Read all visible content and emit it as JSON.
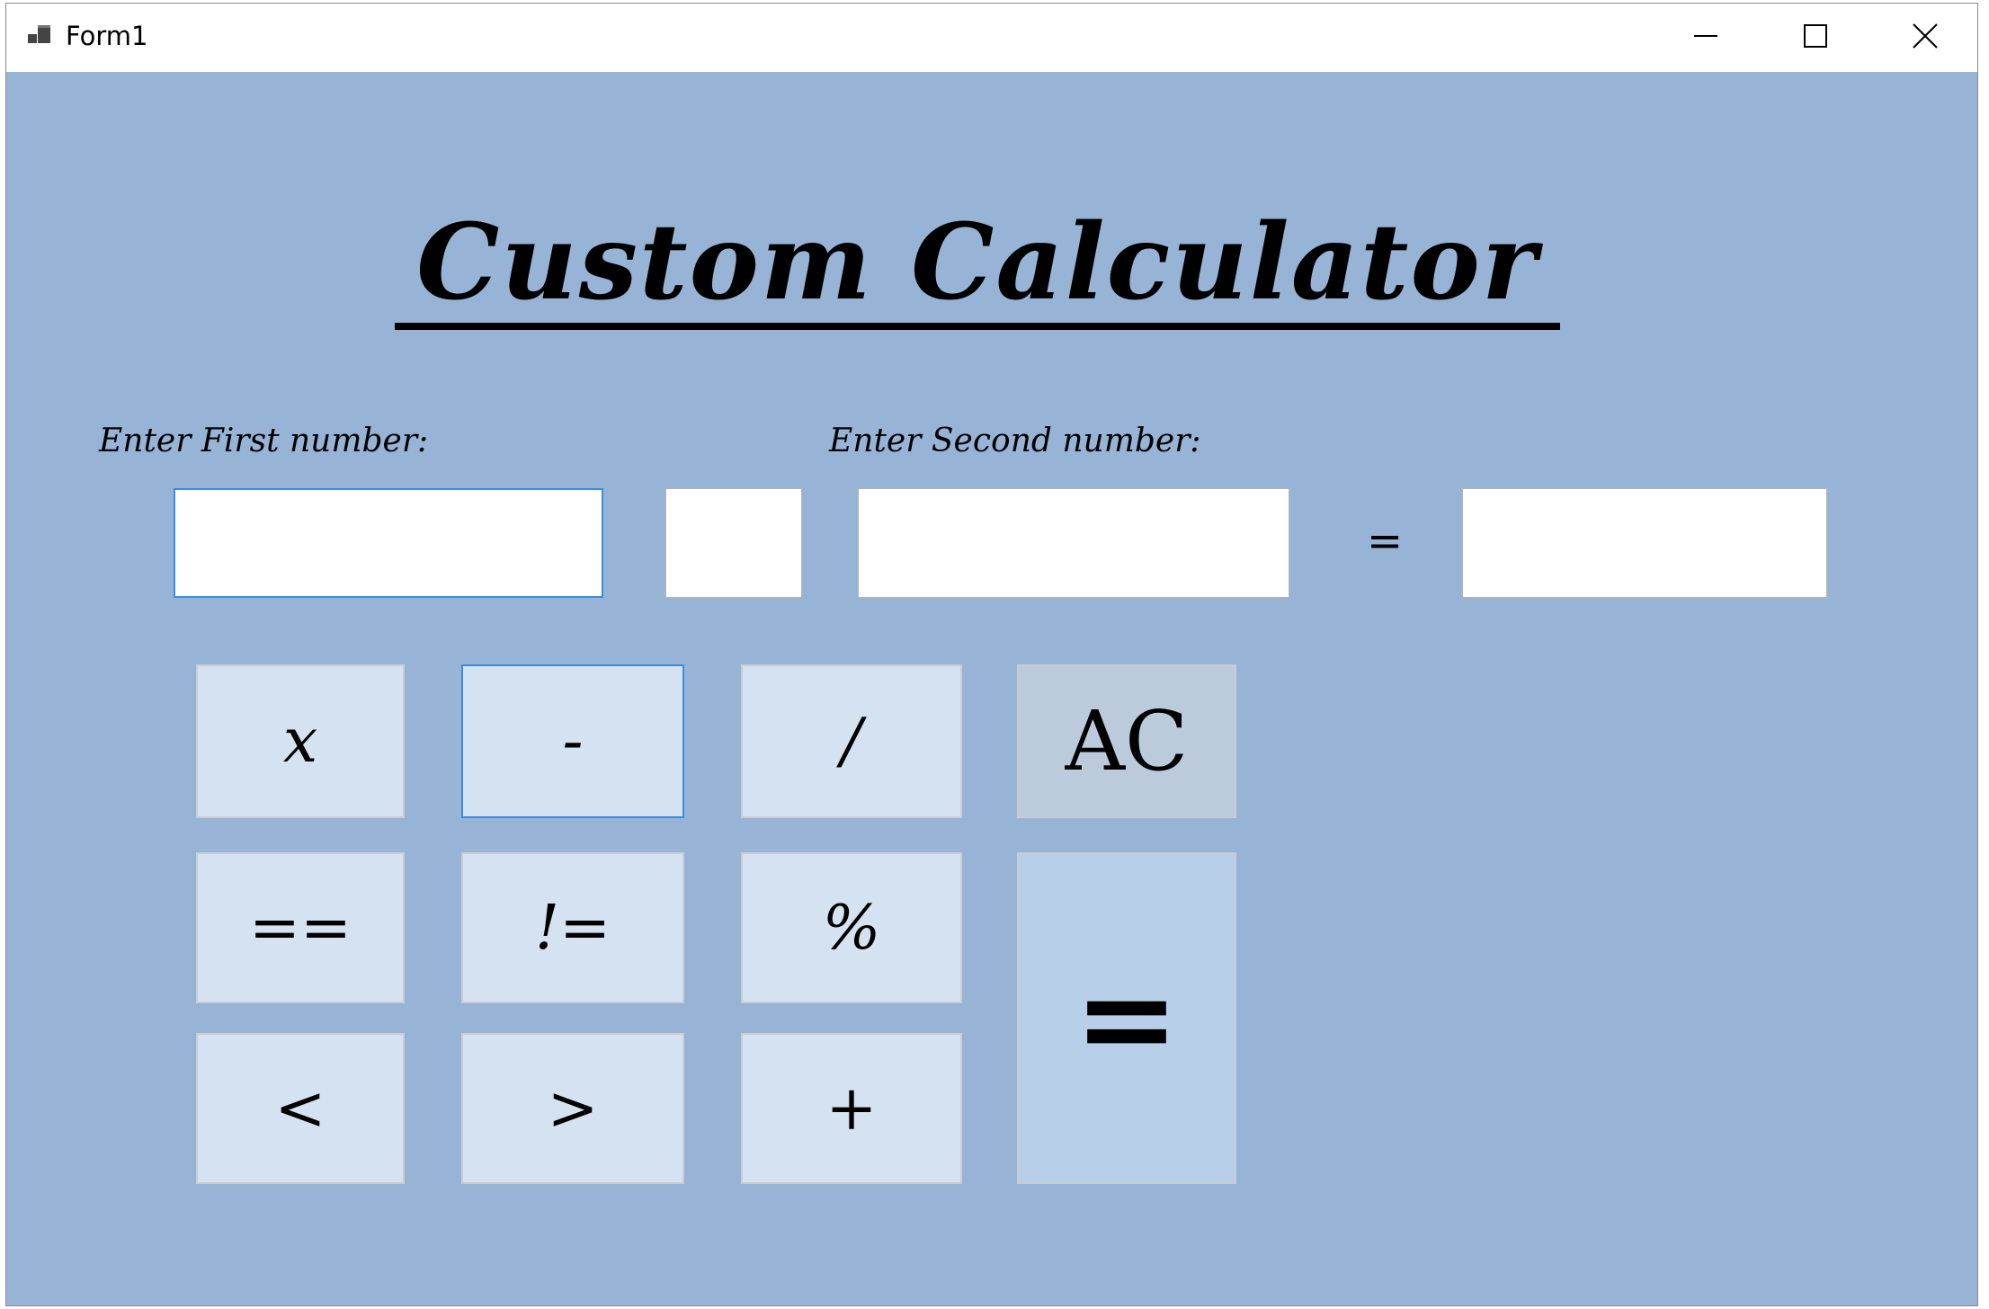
{
  "window": {
    "title": "Form1"
  },
  "titlebar": {
    "minimize_icon": "minimize-icon",
    "maximize_icon": "maximize-icon",
    "close_icon": "close-icon"
  },
  "app": {
    "heading": "Custom Calculator",
    "first_label": "Enter First number:",
    "second_label": "Enter Second number:",
    "equals_text": "=",
    "first_value": "",
    "operator_value": "",
    "second_value": "",
    "result_value": ""
  },
  "buttons": {
    "multiply": "x",
    "subtract": "-",
    "divide": "/",
    "clear": "AC",
    "equal_to": "==",
    "not_equal": "!=",
    "modulo": "%",
    "less_than": "<",
    "greater_than": ">",
    "add": "+",
    "calculate": "="
  },
  "colors": {
    "form_background": "#97b4d6",
    "button_background": "#d5e2f2",
    "clear_button": "#bccbdc",
    "calculate_button": "#b8cfea",
    "focus_border": "#3b8de0"
  }
}
